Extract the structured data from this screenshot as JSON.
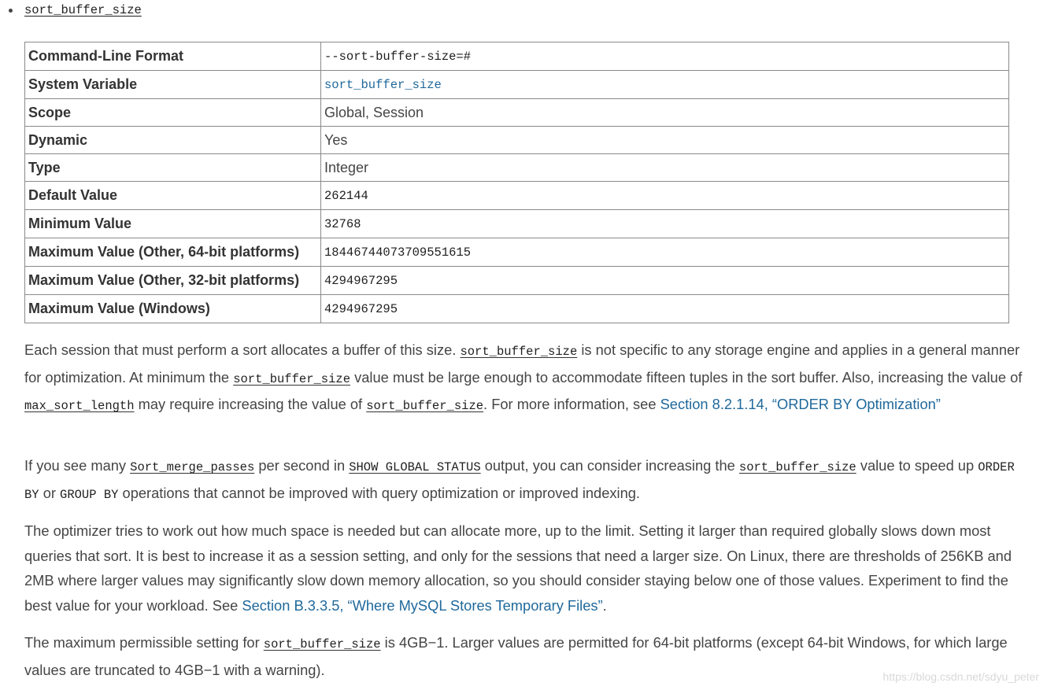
{
  "bullet": {
    "label": "sort_buffer_size"
  },
  "table": {
    "rows": [
      {
        "key": "Command-Line Format",
        "value": "--sort-buffer-size=#"
      },
      {
        "key": "System Variable",
        "value": "sort_buffer_size"
      },
      {
        "key": "Scope",
        "value": "Global, Session"
      },
      {
        "key": "Dynamic",
        "value": "Yes"
      },
      {
        "key": "Type",
        "value": "Integer"
      },
      {
        "key": "Default Value",
        "value": "262144"
      },
      {
        "key": "Minimum Value",
        "value": "32768"
      },
      {
        "key": "Maximum Value (Other, 64-bit platforms)",
        "value": "18446744073709551615"
      },
      {
        "key": "Maximum Value (Other, 32-bit platforms)",
        "value": "4294967295"
      },
      {
        "key": "Maximum Value (Windows)",
        "value": "4294967295"
      }
    ]
  },
  "p1": {
    "t1": "Each session that must perform a sort allocates a buffer of this size. ",
    "c1": "sort_buffer_size",
    "t2": " is not specific to any storage engine and applies in a general manner for optimization. At minimum the ",
    "c2": "sort_buffer_size",
    "t3": " value must be large enough to accommodate fifteen tuples in the sort buffer. Also, increasing the value of ",
    "c3": "max_sort_length",
    "t4": " may require increasing the value of ",
    "c4": "sort_buffer_size",
    "t5": ". For more information, see ",
    "link": "Section 8.2.1.14, “ORDER BY Optimization”"
  },
  "p2": {
    "t1": "If you see many ",
    "c1": "Sort_merge_passes",
    "t2": " per second in ",
    "c2": "SHOW GLOBAL STATUS",
    "t3": " output, you can consider increasing the ",
    "c3": "sort_buffer_size",
    "t4": " value to speed up ",
    "c4": "ORDER BY",
    "t5": " or ",
    "c5": "GROUP BY",
    "t6": " operations that cannot be improved with query optimization or improved indexing."
  },
  "p3": {
    "t1": "The optimizer tries to work out how much space is needed but can allocate more, up to the limit. Setting it larger than required globally slows down most queries that sort. It is best to increase it as a session setting, and only for the sessions that need a larger size. On Linux, there are thresholds of 256KB and 2MB where larger values may significantly slow down memory allocation, so you should consider staying below one of those values. Experiment to find the best value for your workload. See ",
    "link": "Section B.3.3.5, “Where MySQL Stores Temporary Files”",
    "t2": "."
  },
  "p4": {
    "t1": "The maximum permissible setting for ",
    "c1": "sort_buffer_size",
    "t2": " is 4GB−1. Larger values are permitted for 64-bit platforms (except 64-bit Windows, for which large values are truncated to 4GB−1 with a warning)."
  },
  "watermark": "https://blog.csdn.net/sdyu_peter"
}
